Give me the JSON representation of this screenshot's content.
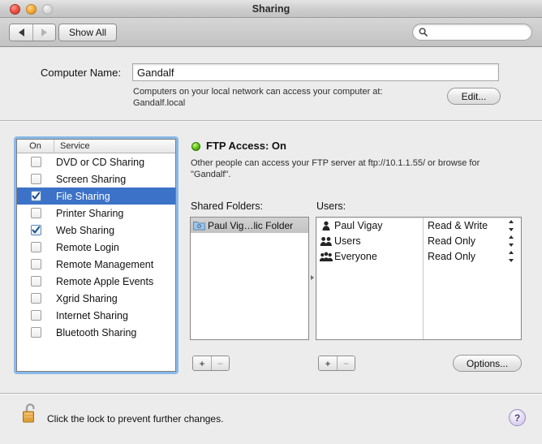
{
  "window": {
    "title": "Sharing",
    "traffic_lights": [
      {
        "name": "close",
        "color": "#f0574b",
        "enabled": true
      },
      {
        "name": "minimize",
        "color": "#f5b03c",
        "enabled": true
      },
      {
        "name": "zoom",
        "color": "#dcdcdc",
        "enabled": false
      }
    ]
  },
  "toolbar": {
    "back_label": "back-arrow",
    "forward_label": "forward-arrow",
    "show_all_label": "Show All",
    "search_placeholder": "",
    "search_value": "",
    "search_icon": "search-icon"
  },
  "computer_name": {
    "label": "Computer Name:",
    "value": "Gandalf",
    "description_line1": "Computers on your local network can access your computer at:",
    "description_line2": "Gandalf.local",
    "edit_label": "Edit..."
  },
  "services": {
    "col_on": "On",
    "col_service": "Service",
    "items": [
      {
        "label": "DVD or CD Sharing",
        "checked": false,
        "selected": false
      },
      {
        "label": "Screen Sharing",
        "checked": false,
        "selected": false
      },
      {
        "label": "File Sharing",
        "checked": true,
        "selected": true
      },
      {
        "label": "Printer Sharing",
        "checked": false,
        "selected": false
      },
      {
        "label": "Web Sharing",
        "checked": true,
        "selected": false
      },
      {
        "label": "Remote Login",
        "checked": false,
        "selected": false
      },
      {
        "label": "Remote Management",
        "checked": false,
        "selected": false
      },
      {
        "label": "Remote Apple Events",
        "checked": false,
        "selected": false
      },
      {
        "label": "Xgrid Sharing",
        "checked": false,
        "selected": false
      },
      {
        "label": "Internet Sharing",
        "checked": false,
        "selected": false
      },
      {
        "label": "Bluetooth Sharing",
        "checked": false,
        "selected": false
      }
    ],
    "selection_color": "#3c72c8",
    "focus_ring_color": "#89b9e8"
  },
  "detail": {
    "status_title": "FTP Access: On",
    "status_indicator_color": "#62c412",
    "status_description_line1": "Other people can access your FTP server at ftp://10.1.1.55/ or browse for",
    "status_description_line2": "\"Gandalf\".",
    "shared_folders_label": "Shared Folders:",
    "users_label": "Users:",
    "shared_folders": [
      {
        "label": "Paul Vig…lic Folder",
        "selected": true,
        "icon": "folder-icon"
      }
    ],
    "users": [
      {
        "name": "Paul Vigay",
        "permission": "Read & Write",
        "icon": "single-user-icon"
      },
      {
        "name": "Users",
        "permission": "Read Only",
        "icon": "group-users-icon"
      },
      {
        "name": "Everyone",
        "permission": "Read Only",
        "icon": "everyone-users-icon"
      }
    ],
    "add_label": "+",
    "remove_label": "−",
    "options_label": "Options..."
  },
  "footer": {
    "lock_icon": "open-lock-icon",
    "lock_text": "Click the lock to prevent further changes.",
    "help_label": "?"
  }
}
